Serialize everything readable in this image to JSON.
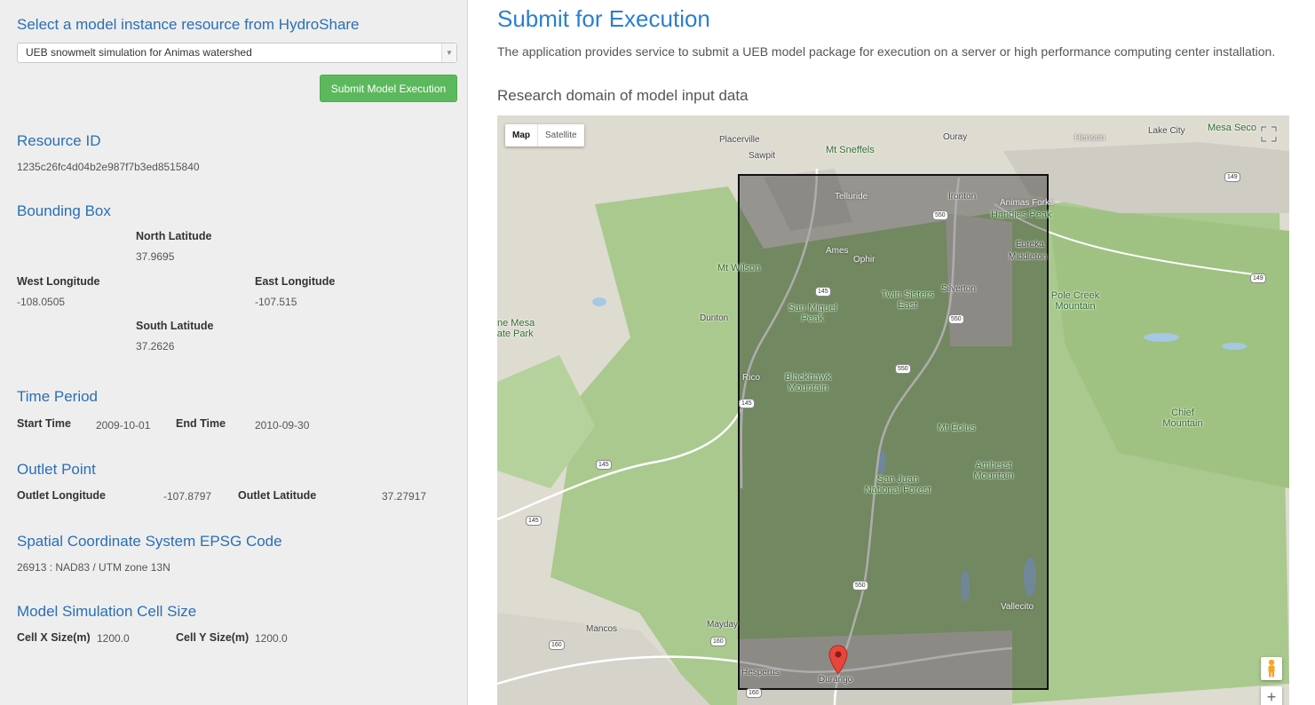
{
  "sidebar": {
    "select_heading": "Select a model instance resource from HydroShare",
    "selected_resource": "UEB snowmelt simulation for Animas watershed",
    "submit_label": "Submit Model Execution",
    "resource_id": {
      "heading": "Resource ID",
      "value": "1235c26fc4d04b2e987f7b3ed8515840"
    },
    "bounding_box": {
      "heading": "Bounding Box",
      "north_label": "North Latitude",
      "north_value": "37.9695",
      "west_label": "West Longitude",
      "west_value": "-108.0505",
      "east_label": "East Longitude",
      "east_value": "-107.515",
      "south_label": "South Latitude",
      "south_value": "37.2626"
    },
    "time_period": {
      "heading": "Time Period",
      "start_label": "Start Time",
      "start_value": "2009-10-01",
      "end_label": "End Time",
      "end_value": "2010-09-30"
    },
    "outlet_point": {
      "heading": "Outlet Point",
      "lon_label": "Outlet Longitude",
      "lon_value": "-107.8797",
      "lat_label": "Outlet Latitude",
      "lat_value": "37.27917"
    },
    "epsg": {
      "heading": "Spatial Coordinate System EPSG Code",
      "value": "26913 : NAD83 / UTM zone 13N"
    },
    "cell_size": {
      "heading": "Model Simulation Cell Size",
      "x_label": "Cell X Size(m)",
      "x_value": "1200.0",
      "y_label": "Cell Y Size(m)",
      "y_value": "1200.0"
    }
  },
  "main": {
    "title": "Submit for Execution",
    "description": "The application provides service to submit a UEB model package for execution on a server or high performance computing center installation.",
    "map_heading": "Research domain of model input data"
  },
  "map": {
    "type_map": "Map",
    "type_satellite": "Satellite",
    "zoom_in": "+",
    "places": {
      "placerville": "Placerville",
      "sawpit": "Sawpit",
      "mt_sneffels": "Mt Sneffels",
      "ouray": "Ouray",
      "henson": "Henson",
      "lake_city": "Lake City",
      "mesa_seco": "Mesa Seco",
      "telluride": "Telluride",
      "ironton": "Ironton",
      "animas_forks": "Animas Forks",
      "handies_peak": "Handies Peak",
      "eureka": "Eureka",
      "middleton": "Middleton",
      "ames": "Ames",
      "ophir": "Ophir",
      "mt_wilson": "Mt Wilson",
      "twin_sisters_east": "Twin Sisters East",
      "silverton": "Silverton",
      "pole_creek_mountain": "Pole Creek Mountain",
      "san_miguel_peak": "San Miguel Peak",
      "dunton": "Dunton",
      "lone_mesa_state_park": "Lone Mesa State Park",
      "rico": "Rico",
      "blackhawk_mountain": "Blackhawk Mountain",
      "chief_mountain": "Chief Mountain",
      "mt_eolus": "Mt Eolus",
      "san_juan_national_forest": "San Juan National Forest",
      "amherst_mountain": "Amherst Mountain",
      "vallecito": "Vallecito",
      "mancos": "Mancos",
      "mayday": "Mayday",
      "hesperus": "Hesperus",
      "durango": "Durango"
    },
    "highways": {
      "h550a": "550",
      "h550b": "550",
      "h550c": "550",
      "h550d": "550",
      "h145a": "145",
      "h145b": "145",
      "h145c": "145",
      "h145d": "145",
      "h149a": "149",
      "h149b": "149",
      "h160a": "160",
      "h160b": "160",
      "h160c": "160"
    }
  }
}
